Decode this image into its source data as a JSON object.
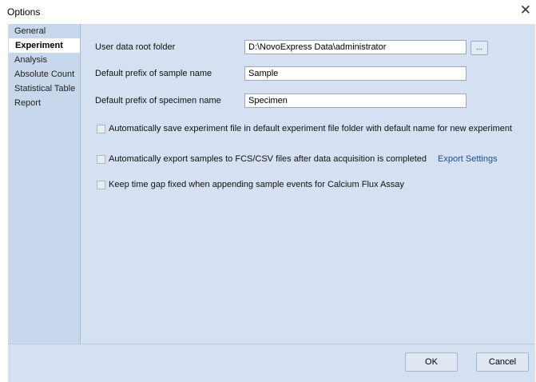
{
  "window": {
    "title": "Options"
  },
  "sidebar": {
    "items": [
      {
        "label": "General",
        "active": false
      },
      {
        "label": "Experiment",
        "active": true
      },
      {
        "label": "Analysis",
        "active": false
      },
      {
        "label": "Absolute Count",
        "active": false
      },
      {
        "label": "Statistical Table",
        "active": false
      },
      {
        "label": "Report",
        "active": false
      }
    ]
  },
  "experiment": {
    "root_folder": {
      "label": "User data root folder",
      "value": "D:\\NovoExpress Data\\administrator",
      "browse_label": "..."
    },
    "sample_prefix": {
      "label": "Default prefix of sample name",
      "value": "Sample"
    },
    "specimen_prefix": {
      "label": "Default prefix of specimen name",
      "value": "Specimen"
    },
    "auto_save": {
      "label": "Automatically save experiment file in default experiment file folder with default name for new experiment",
      "checked": false
    },
    "auto_export": {
      "label": "Automatically export samples to FCS/CSV files after data acquisition is completed",
      "checked": false,
      "link_label": "Export Settings"
    },
    "time_gap": {
      "label": "Keep time gap fixed when appending sample events for Calcium Flux Assay",
      "checked": false
    }
  },
  "footer": {
    "ok_label": "OK",
    "cancel_label": "Cancel"
  },
  "icons": {
    "close": "close-icon",
    "browse": "ellipsis-icon"
  }
}
